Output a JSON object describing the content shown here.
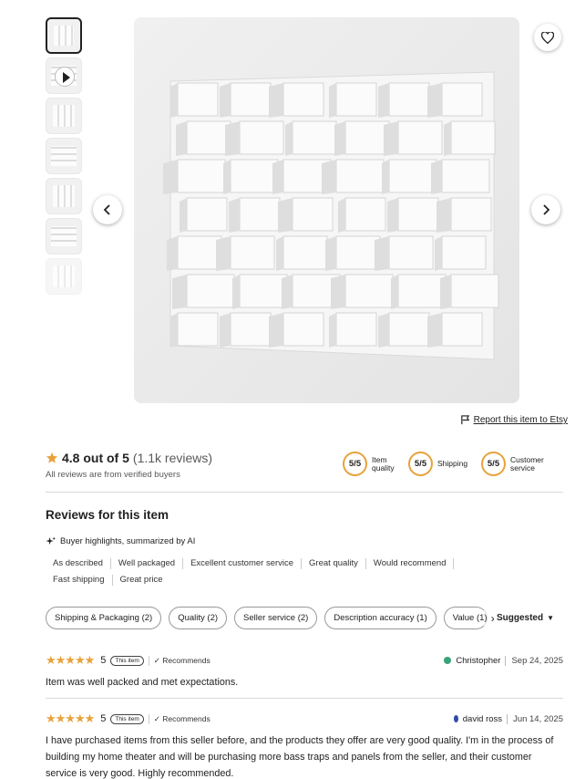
{
  "gallery": {
    "thumbnails": [
      {
        "kind": "image",
        "active": true
      },
      {
        "kind": "video",
        "active": false
      },
      {
        "kind": "image",
        "active": false
      },
      {
        "kind": "image",
        "active": false
      },
      {
        "kind": "image",
        "active": false
      },
      {
        "kind": "image",
        "active": false
      },
      {
        "kind": "image",
        "active": false
      }
    ],
    "favorite_icon": "heart-icon",
    "prev_icon": "chevron-left-icon",
    "next_icon": "chevron-right-icon"
  },
  "report": {
    "icon": "flag-icon",
    "label": "Report this item to Etsy"
  },
  "summary": {
    "rating": "4.8 out of 5",
    "count": "(1.1k reviews)",
    "verified": "All reviews are from verified buyers",
    "scores": [
      {
        "value": "5/5",
        "label": "Item quality"
      },
      {
        "value": "5/5",
        "label": "Shipping"
      },
      {
        "value": "5/5",
        "label": "Customer service"
      }
    ],
    "star_color": "#e8a23a"
  },
  "reviews_section": {
    "title": "Reviews for this item",
    "ai_label": "Buyer highlights, summarized by AI",
    "highlights": [
      "As described",
      "Well packaged",
      "Excellent customer service",
      "Great quality",
      "Would recommend",
      "Fast shipping",
      "Great price"
    ],
    "filters": [
      "Shipping & Packaging (2)",
      "Quality (2)",
      "Seller service (2)",
      "Description accuracy (1)",
      "Value (1)"
    ],
    "sort_label": "Suggested"
  },
  "reviews": [
    {
      "stars": "★★★★★",
      "rating": "5",
      "badge": "This item",
      "recommends": "✓ Recommends",
      "author": "Christopher",
      "avatar_color": "#3aa37a",
      "date": "Sep 24, 2025",
      "text": "Item was well packed and met expectations."
    },
    {
      "stars": "★★★★★",
      "rating": "5",
      "badge": "This item",
      "recommends": "✓ Recommends",
      "author": "david ross",
      "avatar_color": "#2f4aa8",
      "date": "Jun 14, 2025",
      "text": "I have purchased items from this seller before, and the products they offer are very good quality. I'm in the process of building my home theater and will be purchasing more bass traps and panels from the seller, and their customer service is very good. Highly recommended."
    }
  ]
}
